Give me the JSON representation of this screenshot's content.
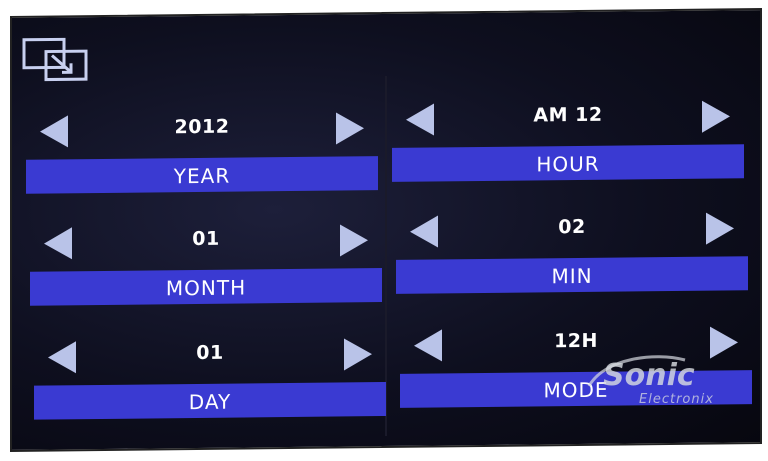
{
  "settings": {
    "year": {
      "value": "2012",
      "label": "YEAR"
    },
    "month": {
      "value": "01",
      "label": "MONTH"
    },
    "day": {
      "value": "01",
      "label": "DAY"
    },
    "hour": {
      "value": "AM 12",
      "label": "HOUR"
    },
    "min": {
      "value": "02",
      "label": "MIN"
    },
    "mode": {
      "value": "12H",
      "label": "MODE"
    }
  },
  "watermark": {
    "brand": "Sonic",
    "sub": "Electronix"
  },
  "colors": {
    "label_bar": "#3a3ad2",
    "arrow": "#b9c3e8",
    "background": "#0e0f1f"
  }
}
